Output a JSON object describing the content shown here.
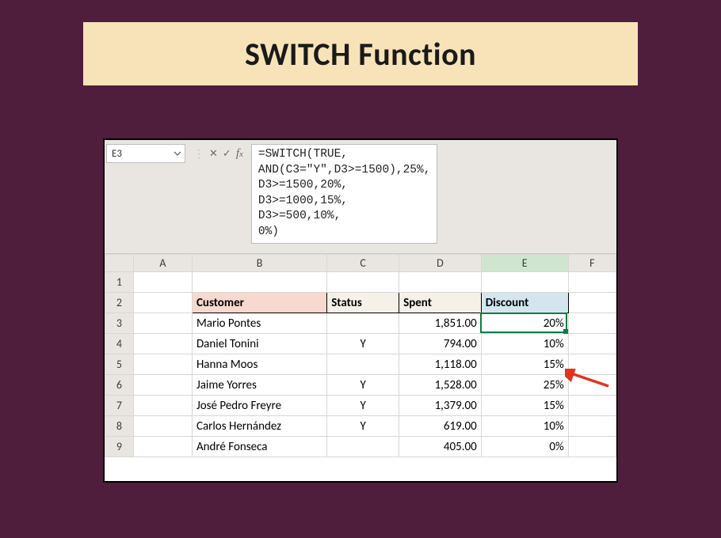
{
  "title": "SWITCH Function",
  "namebox": "E3",
  "formula_lines": [
    "=SWITCH(TRUE,",
    "AND(C3=\"Y\",D3>=1500),25%,",
    "D3>=1500,20%,",
    "D3>=1000,15%,",
    "D3>=500,10%,",
    "0%)"
  ],
  "columns": [
    "A",
    "B",
    "C",
    "D",
    "E",
    "F"
  ],
  "active_column": "E",
  "header_row": 2,
  "headers": {
    "customer": "Customer",
    "status": "Status",
    "spent": "Spent",
    "discount": "Discount"
  },
  "rows": [
    {
      "n": 3,
      "customer": "Mario Pontes",
      "status": "",
      "spent": "1,851.00",
      "discount": "20%"
    },
    {
      "n": 4,
      "customer": "Daniel Tonini",
      "status": "Y",
      "spent": "794.00",
      "discount": "10%"
    },
    {
      "n": 5,
      "customer": "Hanna Moos",
      "status": "",
      "spent": "1,118.00",
      "discount": "15%"
    },
    {
      "n": 6,
      "customer": "Jaime Yorres",
      "status": "Y",
      "spent": "1,528.00",
      "discount": "25%"
    },
    {
      "n": 7,
      "customer": "José Pedro Freyre",
      "status": "Y",
      "spent": "1,379.00",
      "discount": "15%"
    },
    {
      "n": 8,
      "customer": "Carlos Hernández",
      "status": "Y",
      "spent": "619.00",
      "discount": "10%"
    },
    {
      "n": 9,
      "customer": "André Fonseca",
      "status": "",
      "spent": "405.00",
      "discount": "0%"
    }
  ],
  "selected_cell": "E3",
  "arrow_target_row": 6
}
